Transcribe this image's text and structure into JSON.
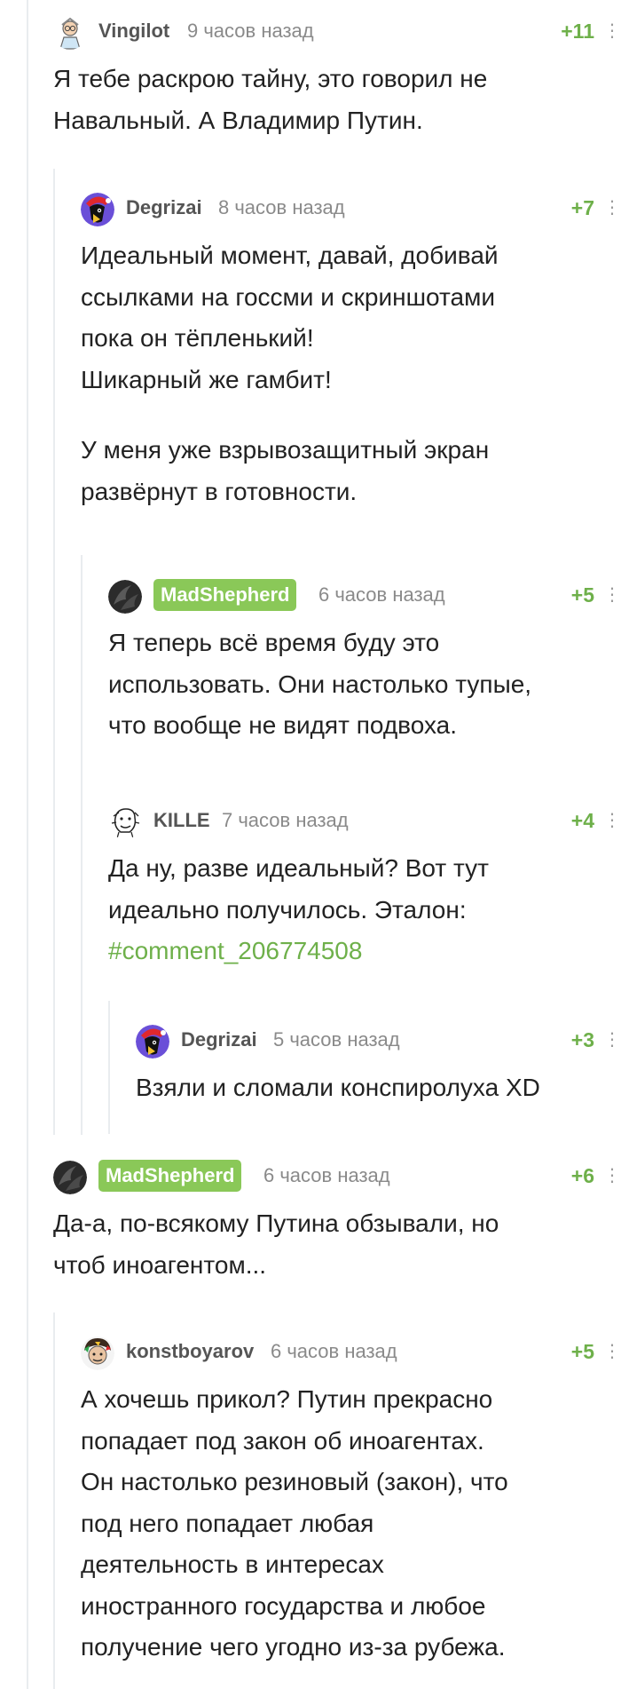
{
  "comments": {
    "c1": {
      "author": "Vingilot",
      "time": "9 часов назад",
      "rating": "+11",
      "text": [
        "Я тебе раскрою тайну, это говорил не",
        "Навальный. А Владимир Путин."
      ]
    },
    "c2": {
      "author": "Degrizai",
      "time": "8 часов назад",
      "rating": "+7",
      "text": [
        "Идеальный момент, давай, добивай",
        "ссылками на госсми и скриншотами",
        "пока он тёпленький!",
        "Шикарный же гамбит!",
        "",
        "У меня уже взрывозащитный экран",
        "развёрнут в готовности."
      ]
    },
    "c3": {
      "author": "MadShepherd",
      "time": "6 часов назад",
      "rating": "+5",
      "text": [
        "Я теперь всё время буду это",
        "использовать. Они настолько тупые,",
        "что вообще не видят подвоха."
      ]
    },
    "c4": {
      "author": "KILLE",
      "time": "7 часов назад",
      "rating": "+4",
      "text": [
        "Да ну, разве идеальный? Вот тут",
        "идеально получилось. Эталон:"
      ],
      "link": "#comment_206774508"
    },
    "c5": {
      "author": "Degrizai",
      "time": "5 часов назад",
      "rating": "+3",
      "text": [
        "Взяли и сломали конспиролуха XD"
      ]
    },
    "c6": {
      "author": "MadShepherd",
      "time": "6 часов назад",
      "rating": "+6",
      "text": [
        "Да-а, по-всякому Путина обзывали, но",
        "чтоб иноагентом..."
      ]
    },
    "c7": {
      "author": "konstboyarov",
      "time": "6 часов назад",
      "rating": "+5",
      "text": [
        "А хочешь прикол? Путин прекрасно",
        "попадает под закон об иноагентах.",
        "Он настолько резиновый (закон), что",
        "под него попадает любая",
        "деятельность в интересах",
        "иностранного государства и любое",
        "получение чего угодно из-за рубежа."
      ]
    }
  },
  "icons": {
    "more": "more-vertical-icon",
    "avatar": "user-avatar"
  },
  "colors": {
    "rating": "#6eb04a",
    "highlight_badge": "#8ac858",
    "link": "#6eb04a",
    "thread_line": "#e9ecef"
  }
}
